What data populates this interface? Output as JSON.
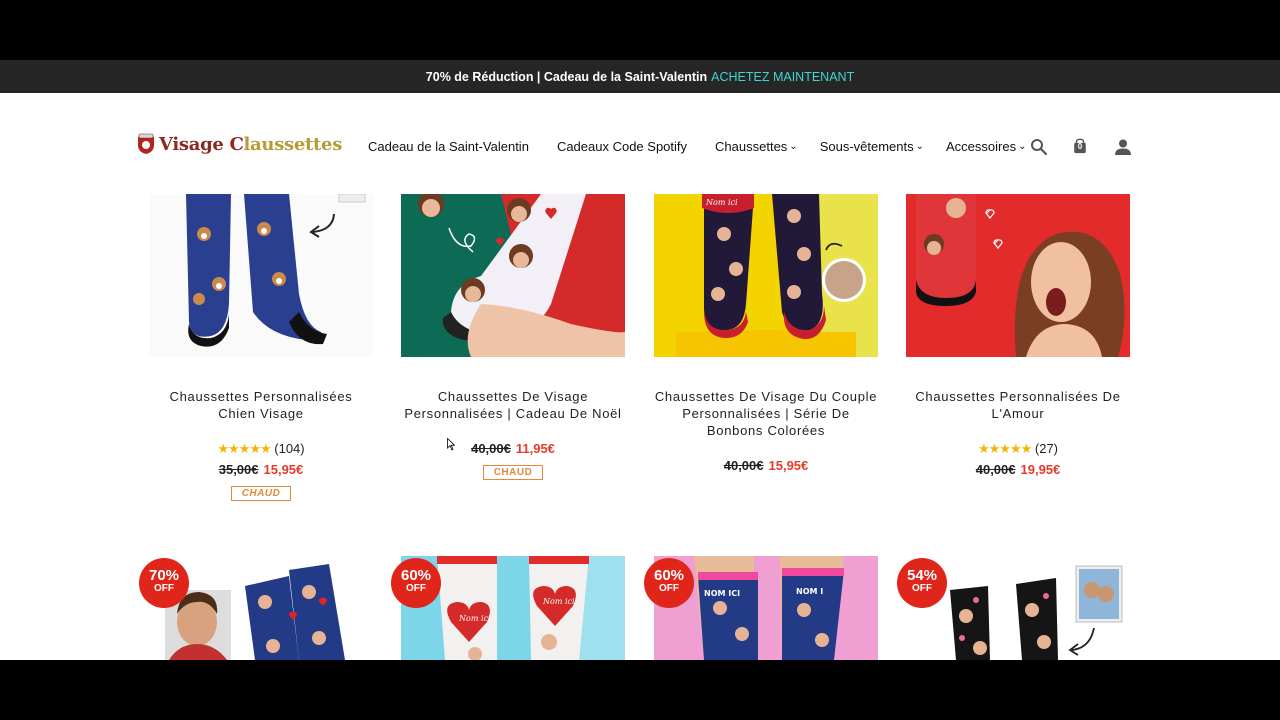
{
  "announcement": {
    "text": "70% de Réduction | Cadeau de la Saint-Valentin",
    "cta": "ACHETEZ MAINTENANT"
  },
  "header": {
    "logo_text_a": "Visage C",
    "logo_text_b": "laussettes",
    "nav": [
      "Cadeau de la Saint-Valentin",
      "Cadeaux Code Spotify",
      "Chaussettes",
      "Sous-vêtements",
      "Accessoires"
    ],
    "cart_count": "0"
  },
  "products": [
    {
      "title": "Chaussettes Personnalisées Chien Visage",
      "reviews": "(104)",
      "old_price": "35,00€",
      "new_price": "15,95€",
      "badge": "CHAUD"
    },
    {
      "title": "Chaussettes De Visage Personnalisées | Cadeau De Noël",
      "old_price": "40,00€",
      "new_price": "11,95€",
      "badge": "CHAUD"
    },
    {
      "title": "Chaussettes De Visage Du Couple Personnalisées | Série De Bonbons Colorées",
      "old_price": "40,00€",
      "new_price": "15,95€"
    },
    {
      "title": "Chaussettes Personnalisées De L'Amour",
      "reviews": "(27)",
      "old_price": "40,00€",
      "new_price": "19,95€"
    }
  ],
  "stars": "★★★★★",
  "discounts": [
    {
      "pct": "70%",
      "off": "OFF"
    },
    {
      "pct": "60%",
      "off": "OFF"
    },
    {
      "pct": "60%",
      "off": "OFF"
    },
    {
      "pct": "54%",
      "off": "OFF"
    }
  ],
  "sock_labels": {
    "nom_ici": "Nom ici",
    "nom_ici_caps": "NOM ICI",
    "nom_i": "NOM I"
  },
  "colors": {
    "accent_cta": "#3ed6d1",
    "price_red": "#e53a2a",
    "badge_orange": "#e08a3c",
    "discount_red": "#e0251b"
  },
  "icons": [
    "search-icon",
    "shopping-bag-icon",
    "user-icon",
    "star-icon"
  ]
}
